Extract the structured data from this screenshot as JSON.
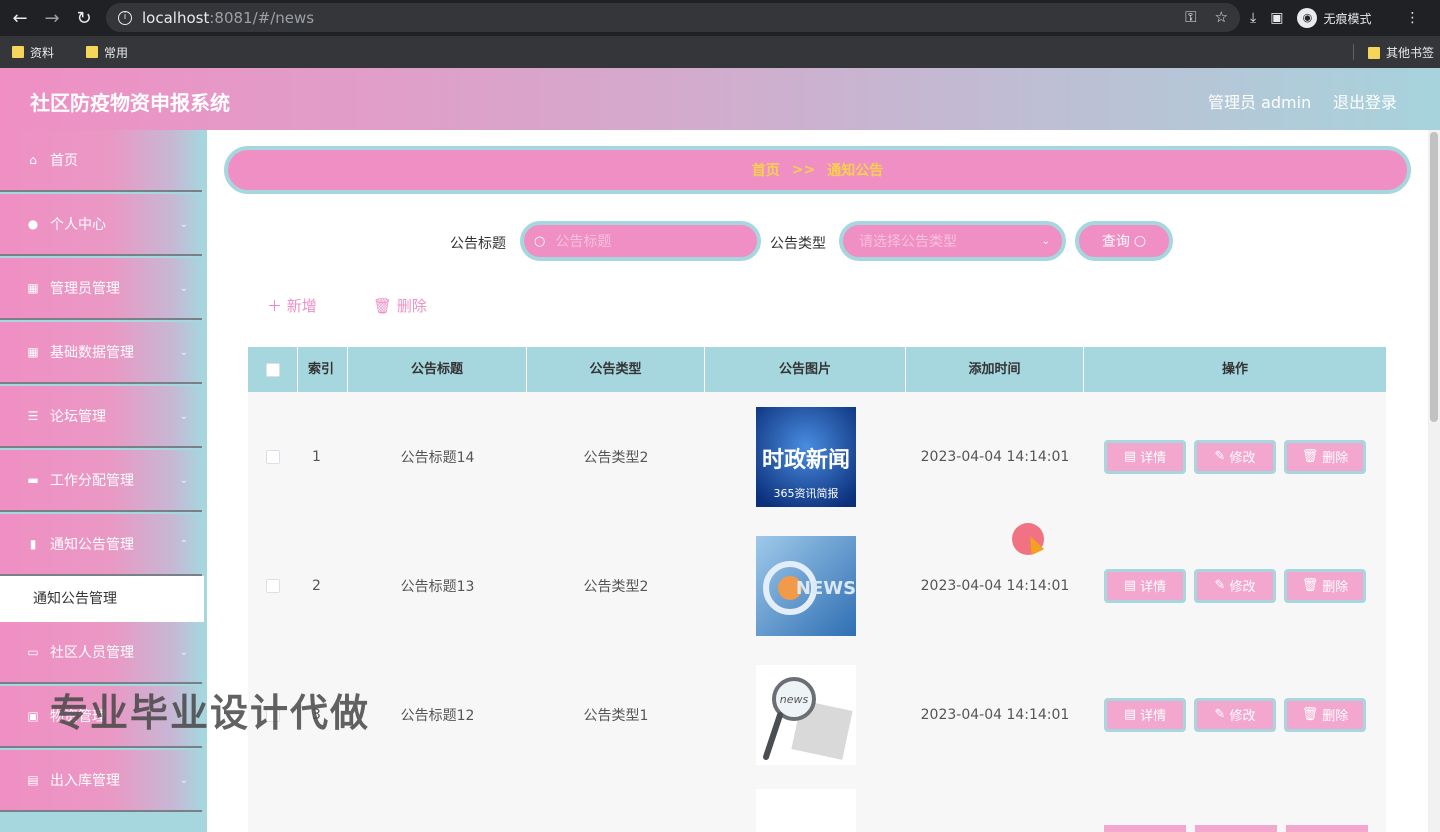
{
  "browser": {
    "url_host": "localhost",
    "url_path": ":8081/#/news",
    "incognito_label": "无痕模式",
    "bookmarks": [
      "资料",
      "常用"
    ],
    "other_bookmarks": "其他书签"
  },
  "header": {
    "title": "社区防疫物资申报系统",
    "user": "管理员 admin",
    "logout": "退出登录"
  },
  "sidebar": {
    "items": [
      {
        "label": "首页"
      },
      {
        "label": "个人中心"
      },
      {
        "label": "管理员管理"
      },
      {
        "label": "基础数据管理"
      },
      {
        "label": "论坛管理"
      },
      {
        "label": "工作分配管理"
      },
      {
        "label": "通知公告管理"
      },
      {
        "label": "社区人员管理"
      },
      {
        "label": "物资管理"
      },
      {
        "label": "出入库管理"
      }
    ],
    "active_sub": "通知公告管理"
  },
  "breadcrumb": {
    "home": "首页",
    "sep": ">>",
    "current": "通知公告"
  },
  "filters": {
    "title_label": "公告标题",
    "title_placeholder": "公告标题",
    "type_label": "公告类型",
    "type_placeholder": "请选择公告类型",
    "query": "查询"
  },
  "actions": {
    "add": "新增",
    "delete": "删除"
  },
  "table": {
    "headers": [
      "索引",
      "公告标题",
      "公告类型",
      "公告图片",
      "添加时间",
      "操作"
    ],
    "rows": [
      {
        "index": "1",
        "title": "公告标题14",
        "type": "公告类型2",
        "time": "2023-04-04 14:14:01",
        "img": "时政新闻",
        "img_sub": "365资讯简报"
      },
      {
        "index": "2",
        "title": "公告标题13",
        "type": "公告类型2",
        "time": "2023-04-04 14:14:01",
        "img": "NEWS",
        "img_sub": ""
      },
      {
        "index": "3",
        "title": "公告标题12",
        "type": "公告类型1",
        "time": "2023-04-04 14:14:01",
        "img": "news",
        "img_sub": ""
      }
    ],
    "op_detail": "详情",
    "op_edit": "修改",
    "op_delete": "删除"
  },
  "watermark": "专业毕业设计代做"
}
